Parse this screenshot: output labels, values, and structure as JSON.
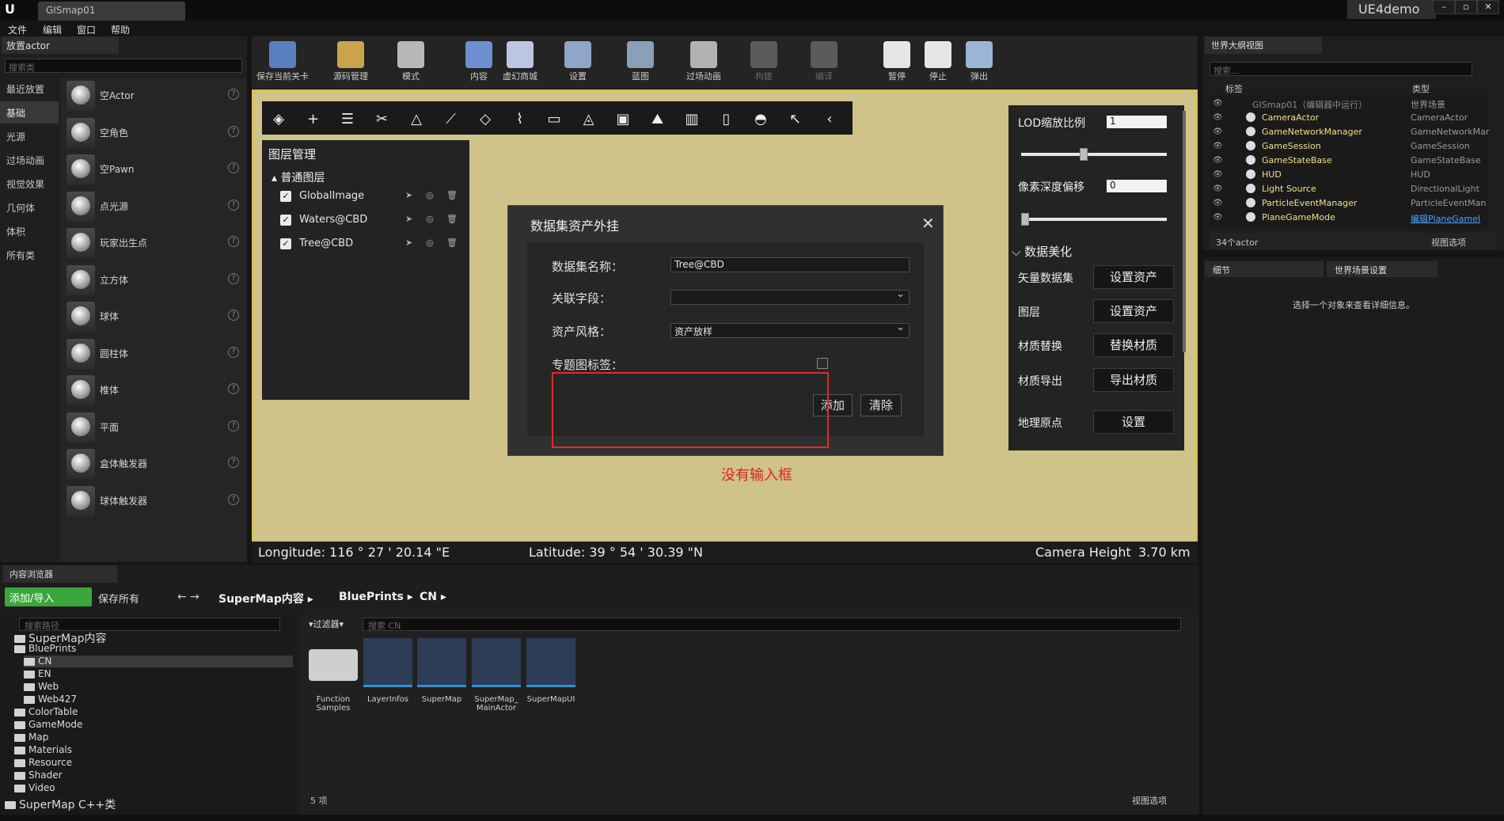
{
  "window": {
    "tab": "GISmap01",
    "project": "UE4demo"
  },
  "menu": [
    "文件",
    "编辑",
    "窗口",
    "帮助"
  ],
  "place": {
    "tab": "放置actor",
    "search_placeholder": "搜索类",
    "categories": [
      "最近放置",
      "基础",
      "光源",
      "过场动画",
      "视觉效果",
      "几何体",
      "体积",
      "所有类"
    ],
    "items": [
      "空Actor",
      "空角色",
      "空Pawn",
      "点光源",
      "玩家出生点",
      "立方体",
      "球体",
      "圆柱体",
      "椎体",
      "平面",
      "盒体触发器",
      "球体触发器"
    ]
  },
  "toolbar": [
    {
      "label": "保存当前关卡",
      "icon": "save-icon"
    },
    {
      "label": "源码管理",
      "icon": "source-control-icon"
    },
    {
      "label": "模式",
      "icon": "modes-icon"
    },
    {
      "label": "内容",
      "icon": "content-icon"
    },
    {
      "label": "虚幻商城",
      "icon": "marketplace-icon"
    },
    {
      "label": "设置",
      "icon": "settings-icon"
    },
    {
      "label": "蓝图",
      "icon": "blueprint-icon"
    },
    {
      "label": "过场动画",
      "icon": "cinematics-icon"
    },
    {
      "label": "构建",
      "icon": "build-icon"
    },
    {
      "label": "编译",
      "icon": "compile-icon"
    },
    {
      "label": "暂停",
      "icon": "pause-icon"
    },
    {
      "label": "停止",
      "icon": "stop-icon"
    },
    {
      "label": "弹出",
      "icon": "eject-icon"
    }
  ],
  "layers": {
    "title": "图层管理",
    "group": "普通图层",
    "items": [
      "GlobalImage",
      "Waters@CBD",
      "Tree@CBD"
    ]
  },
  "dialog": {
    "title": "数据集资产外挂",
    "name_label": "数据集名称：",
    "name_value": "Tree@CBD",
    "field_label": "关联字段：",
    "field_value": "",
    "style_label": "资产风格：",
    "style_value": "资产放样",
    "tag_label": "专题图标签：",
    "add_label": "添加",
    "clear_label": "清除"
  },
  "annotation": "没有输入框",
  "beauty": {
    "lod_label": "LOD缩放比例",
    "lod_value": "1",
    "lod_level": 0.4,
    "depth_label": "像素深度偏移",
    "depth_value": "0",
    "depth_level": 0.0,
    "section": "数据美化",
    "rows": [
      {
        "label": "矢量数据集",
        "button": "设置资产"
      },
      {
        "label": "图层",
        "button": "设置资产"
      },
      {
        "label": "材质替换",
        "button": "替换材质"
      },
      {
        "label": "材质导出",
        "button": "导出材质"
      },
      {
        "label": "地理原点",
        "button": "设置"
      }
    ]
  },
  "status": {
    "longitude": "Longitude: 116 ° 27 ' 20.14 \"E",
    "latitude": "Latitude: 39 ° 54 ' 30.39 \"N",
    "camera_label": "Camera Height",
    "camera_value": "3.70 km"
  },
  "outliner": {
    "tab": "世界大纲视图",
    "search_placeholder": "搜索...",
    "col_label": "标签",
    "col_type": "类型",
    "root_name": "GISmap01（编辑器中运行）",
    "root_type": "世界场景",
    "rows": [
      {
        "name": "CameraActor",
        "type": "CameraActor"
      },
      {
        "name": "GameNetworkManager",
        "type": "GameNetworkMar"
      },
      {
        "name": "GameSession",
        "type": "GameSession"
      },
      {
        "name": "GameStateBase",
        "type": "GameStateBase"
      },
      {
        "name": "HUD",
        "type": "HUD"
      },
      {
        "name": "Light Source",
        "type": "DirectionalLight"
      },
      {
        "name": "ParticleEventManager",
        "type": "ParticleEventMan"
      },
      {
        "name": "PlaneGameMode",
        "type": "编辑PlaneGameI"
      }
    ],
    "count": "34个actor",
    "view_options": "视图选项"
  },
  "details": {
    "tab": "细节",
    "tab2": "世界场景设置",
    "message": "选择一个对象来查看详细信息。"
  },
  "content": {
    "tab": "内容浏览器",
    "add": "添加/导入",
    "save": "保存所有",
    "crumbs": [
      "SuperMap内容",
      "BluePrints",
      "CN"
    ],
    "path_placeholder": "搜索路径",
    "filter": "过滤器",
    "search_placeholder": "搜索 CN",
    "tree": [
      "SuperMap内容",
      "BluePrints",
      "CN",
      "EN",
      "Web",
      "Web427",
      "ColorTable",
      "GameMode",
      "Map",
      "Materials",
      "Resource",
      "Shader",
      "Video",
      "SuperMap C++类"
    ],
    "assets": [
      "Function Samples",
      "LayerInfos",
      "SuperMap",
      "SuperMap_ MainActor",
      "SuperMapUI"
    ],
    "count": "5 项",
    "view_options": "视图选项"
  }
}
